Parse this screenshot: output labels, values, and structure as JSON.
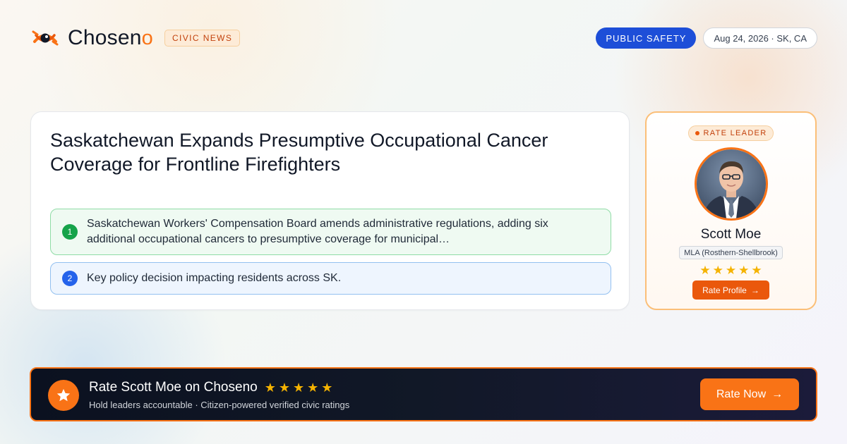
{
  "brand": {
    "name_main": "Chosen",
    "name_accent": "o",
    "logo_icon": "eye-logo-icon",
    "badge": "CIVIC NEWS"
  },
  "header": {
    "category": "PUBLIC SAFETY",
    "date_location": "Aug 24, 2026 · SK, CA"
  },
  "article": {
    "headline": "Saskatchewan Expands Presumptive Occupational Cancer Coverage for Frontline Firefighters",
    "points": [
      {
        "number": "1",
        "text": "Saskatchewan Workers' Compensation Board amends administrative regulations, adding six additional occupational cancers to presumptive coverage for municipal…"
      },
      {
        "number": "2",
        "text": "Key policy decision impacting residents across SK."
      }
    ]
  },
  "leader_card": {
    "badge": "RATE LEADER",
    "name": "Scott Moe",
    "role": "MLA (Rosthern-Shellbrook)",
    "rating": 5,
    "button_label": "Rate Profile",
    "button_icon": "→"
  },
  "banner": {
    "title": "Rate Scott Moe on Choseno",
    "subtitle": "Hold leaders accountable · Citizen-powered verified civic ratings",
    "rating": 5,
    "button_label": "Rate Now",
    "button_icon": "→",
    "star_icon": "★"
  },
  "colors": {
    "accent": "#f97316",
    "category": "#1d4ed8",
    "point_1": "#16a34a",
    "point_2": "#2563eb",
    "star": "#f5b301"
  }
}
